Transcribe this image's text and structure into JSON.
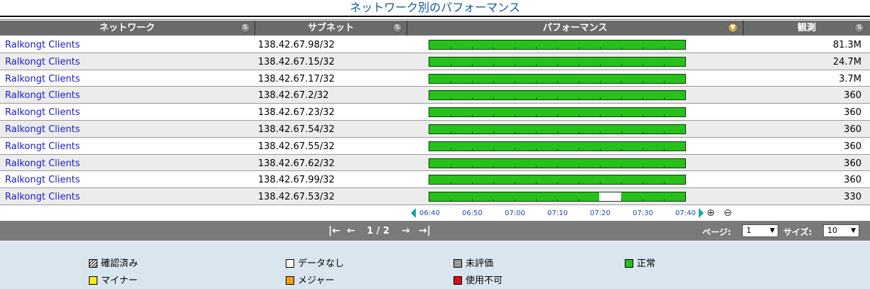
{
  "title": "ネットワーク別のパフォーマンス",
  "columns": {
    "network": "ネットワーク",
    "subnet": "サブネット",
    "performance": "パフォーマンス",
    "observed": "観測"
  },
  "rows": [
    {
      "network": "Ralkongt Clients",
      "subnet": "138.42.67.98/32",
      "observed": "81.3M"
    },
    {
      "network": "Ralkongt Clients",
      "subnet": "138.42.67.15/32",
      "observed": "24.7M"
    },
    {
      "network": "Ralkongt Clients",
      "subnet": "138.42.67.17/32",
      "observed": "3.7M"
    },
    {
      "network": "Ralkongt Clients",
      "subnet": "138.42.67.2/32",
      "observed": "360"
    },
    {
      "network": "Ralkongt Clients",
      "subnet": "138.42.67.23/32",
      "observed": "360"
    },
    {
      "network": "Ralkongt Clients",
      "subnet": "138.42.67.54/32",
      "observed": "360"
    },
    {
      "network": "Ralkongt Clients",
      "subnet": "138.42.67.55/32",
      "observed": "360"
    },
    {
      "network": "Ralkongt Clients",
      "subnet": "138.42.67.62/32",
      "observed": "360"
    },
    {
      "network": "Ralkongt Clients",
      "subnet": "138.42.67.99/32",
      "observed": "360"
    },
    {
      "network": "Ralkongt Clients",
      "subnet": "138.42.67.53/32",
      "observed": "330",
      "gap": [
        0.665,
        0.75
      ]
    }
  ],
  "timeline": {
    "labels": [
      "06:40",
      "06:50",
      "07:00",
      "07:10",
      "07:20",
      "07:30",
      "07:40"
    ]
  },
  "pager": {
    "page": "1 / 2",
    "page_label": "ページ:",
    "page_value": "1",
    "size_label": "サイズ:",
    "size_value": "10"
  },
  "legend": [
    {
      "label": "確認済み",
      "color": "hatched"
    },
    {
      "label": "データなし",
      "color": "#ffffff"
    },
    {
      "label": "未評価",
      "color": "#9a9a9a"
    },
    {
      "label": "正常",
      "color": "#26c21a"
    },
    {
      "label": "マイナー",
      "color": "#f5e81a"
    },
    {
      "label": "メジャー",
      "color": "#f5a01a"
    },
    {
      "label": "使用不可",
      "color": "#d81010"
    }
  ]
}
